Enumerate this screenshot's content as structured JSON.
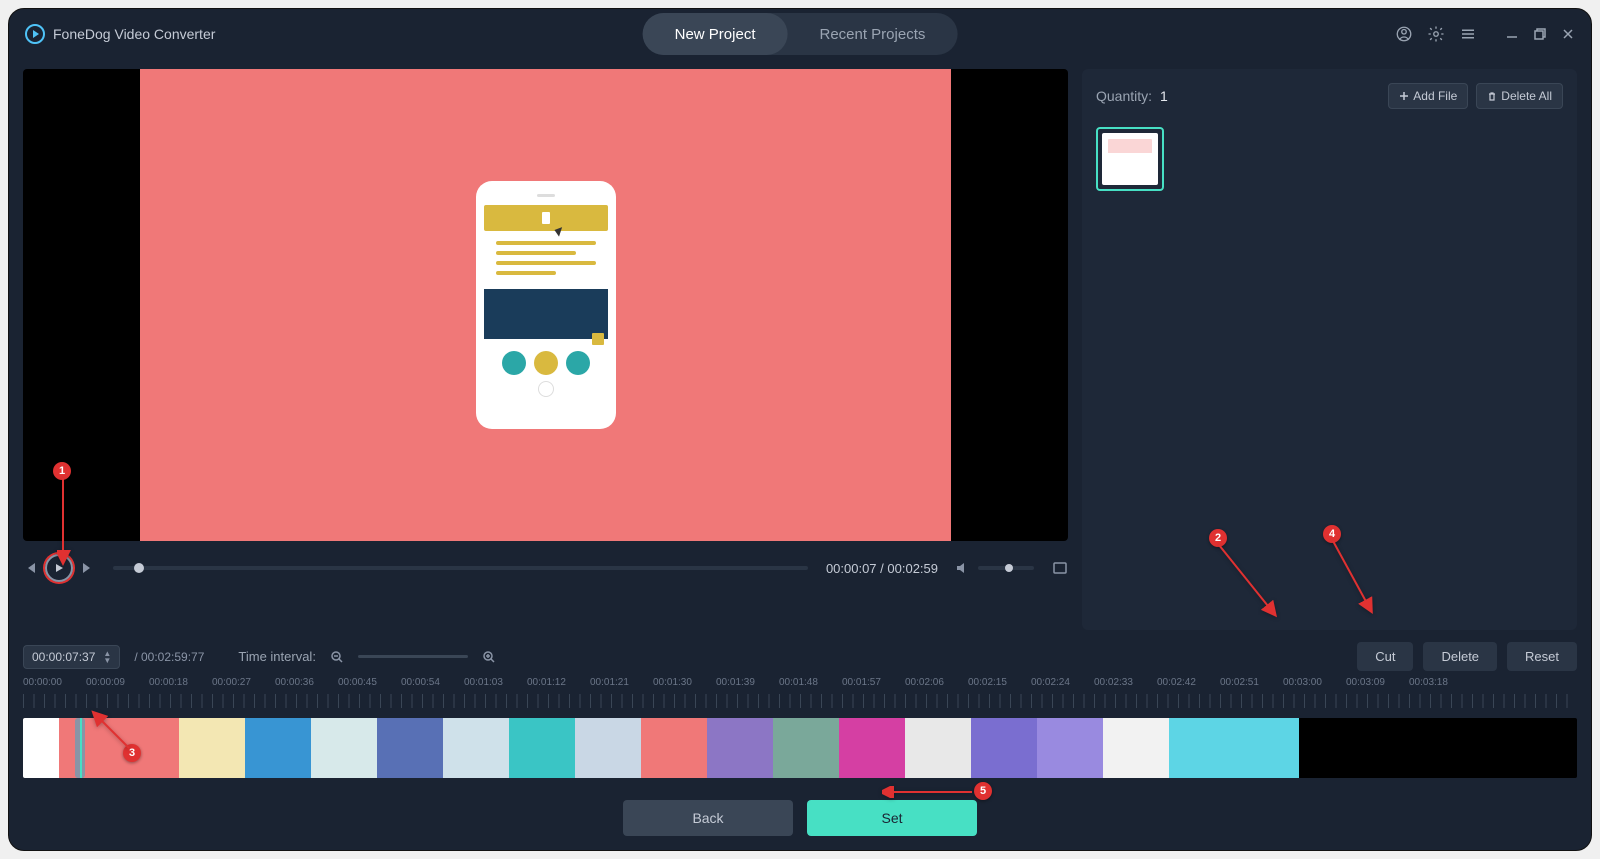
{
  "app": {
    "title": "FoneDog Video Converter"
  },
  "tabs": {
    "new_project": "New Project",
    "recent_projects": "Recent Projects"
  },
  "sidebar": {
    "quantity_label": "Quantity:",
    "quantity_value": "1",
    "add_file": "Add File",
    "delete_all": "Delete All"
  },
  "player": {
    "current_time": "00:00:07",
    "total_time": "00:02:59",
    "separator": " / "
  },
  "toolbar": {
    "time_input": "00:00:07:37",
    "duration": "/ 00:02:59:77",
    "interval_label": "Time interval:",
    "cut": "Cut",
    "delete": "Delete",
    "reset": "Reset"
  },
  "ruler": {
    "ticks": [
      "00:00:00",
      "00:00:09",
      "00:00:18",
      "00:00:27",
      "00:00:36",
      "00:00:45",
      "00:00:54",
      "00:01:03",
      "00:01:12",
      "00:01:21",
      "00:01:30",
      "00:01:39",
      "00:01:48",
      "00:01:57",
      "00:02:06",
      "00:02:15",
      "00:02:24",
      "00:02:33",
      "00:02:42",
      "00:02:51",
      "00:03:00",
      "00:03:09",
      "00:03:18"
    ]
  },
  "bottom": {
    "back": "Back",
    "set": "Set"
  },
  "annotations": {
    "n1": "1",
    "n2": "2",
    "n3": "3",
    "n4": "4",
    "n5": "5"
  }
}
